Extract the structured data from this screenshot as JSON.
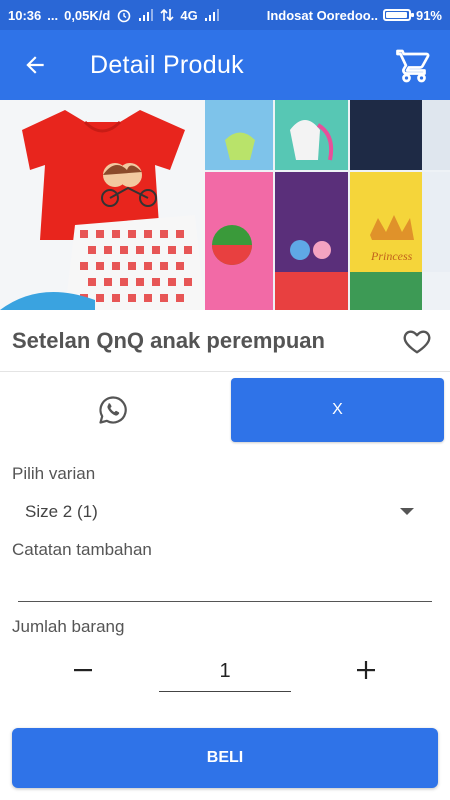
{
  "status_bar": {
    "time": "10:36",
    "dots": "...",
    "speed": "0,05K/d",
    "network": "4G",
    "carrier": "Indosat Ooredoo..",
    "battery": "91%"
  },
  "app_bar": {
    "title": "Detail Produk",
    "back_icon": "arrow-left-icon",
    "cart_icon": "cart-icon"
  },
  "product": {
    "name": "Setelan QnQ anak perempuan",
    "image_print_text": "Princess",
    "favorite_icon": "heart-outline-icon"
  },
  "actions": {
    "whatsapp_icon": "whatsapp-icon",
    "x_label": "X"
  },
  "variant": {
    "label": "Pilih varian",
    "selected": "Size 2 (1)"
  },
  "note": {
    "label": "Catatan tambahan",
    "value": ""
  },
  "quantity": {
    "label": "Jumlah barang",
    "minus": "−",
    "plus": "+",
    "value": "1"
  },
  "buy_button": {
    "label": "BELI"
  },
  "colors": {
    "primary": "#2f73e8",
    "status_bar": "#2a67d6",
    "text_dark": "#545454"
  }
}
